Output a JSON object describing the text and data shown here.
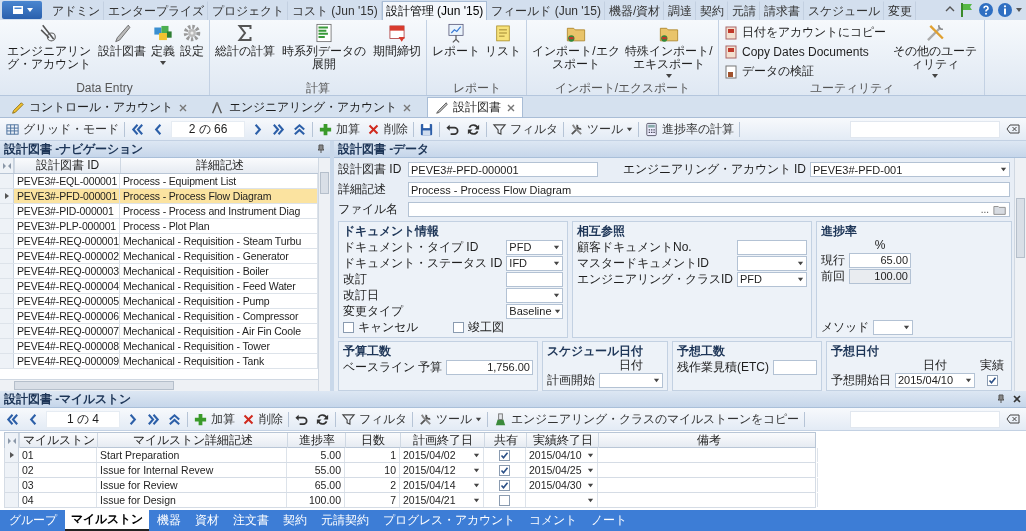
{
  "ribbon": {
    "tabs": [
      {
        "label": "アドミン",
        "selected": false
      },
      {
        "label": "エンタープライズ",
        "selected": false
      },
      {
        "label": "プロジェクト",
        "selected": false
      },
      {
        "label": "コスト (Jun '15)",
        "selected": false
      },
      {
        "label": "設計管理 (Jun '15)",
        "selected": true
      },
      {
        "label": "フィールド (Jun '15)",
        "selected": false
      },
      {
        "label": "機器/資材",
        "selected": false
      },
      {
        "label": "調達",
        "selected": false
      },
      {
        "label": "契約",
        "selected": false
      },
      {
        "label": "元請",
        "selected": false
      },
      {
        "label": "請求書",
        "selected": false
      },
      {
        "label": "スケジュール",
        "selected": false
      },
      {
        "label": "変更",
        "selected": false
      }
    ],
    "groups": [
      {
        "label": "Data Entry",
        "items": [
          {
            "label": "エンジニアリング・アカウント",
            "kind": "large",
            "dropdown": false
          },
          {
            "label": "設計図書",
            "kind": "large",
            "dropdown": false
          },
          {
            "label": "定義",
            "kind": "large",
            "dropdown": true
          },
          {
            "label": "設定",
            "kind": "large",
            "dropdown": false
          }
        ]
      },
      {
        "label": "計算",
        "items": [
          {
            "label": "総計の計算",
            "kind": "large",
            "dropdown": false
          },
          {
            "label": "時系列データの展開",
            "kind": "large",
            "dropdown": false
          },
          {
            "label": "期間締切",
            "kind": "large",
            "dropdown": false
          }
        ]
      },
      {
        "label": "レポート",
        "items": [
          {
            "label": "レポート",
            "kind": "large",
            "dropdown": false
          },
          {
            "label": "リスト",
            "kind": "large",
            "dropdown": false
          }
        ]
      },
      {
        "label": "インポート/エクスポート",
        "items": [
          {
            "label": "インポート/エクスポート",
            "kind": "large",
            "dropdown": false
          },
          {
            "label": "特殊インポート/エキスポート",
            "kind": "large",
            "dropdown": true
          }
        ]
      },
      {
        "label": "ユーティリティ",
        "items": [
          {
            "label": "日付をアカウントにコピー",
            "kind": "small",
            "dropdown": false
          },
          {
            "label": "Copy Dates Documents",
            "kind": "small",
            "dropdown": false
          },
          {
            "label": "データの検証",
            "kind": "small",
            "dropdown": false
          },
          {
            "label": "その他のユーティリティ",
            "kind": "large",
            "dropdown": true
          }
        ]
      }
    ]
  },
  "doc_tabs": [
    {
      "label": "コントロール・アカウント",
      "selected": false
    },
    {
      "label": "エンジニアリング・アカウント",
      "selected": false
    },
    {
      "label": "設計図書",
      "selected": true
    }
  ],
  "toolbar": {
    "items": [
      {
        "kind": "grid",
        "label": "グリッド・モード"
      },
      {
        "kind": "sep"
      },
      {
        "kind": "first"
      },
      {
        "kind": "prev"
      },
      {
        "kind": "pager",
        "label": "2 の 66"
      },
      {
        "kind": "next"
      },
      {
        "kind": "last"
      },
      {
        "kind": "up"
      },
      {
        "kind": "sep"
      },
      {
        "kind": "add",
        "label": "加算"
      },
      {
        "kind": "delete",
        "label": "削除"
      },
      {
        "kind": "sep"
      },
      {
        "kind": "save"
      },
      {
        "kind": "sep"
      },
      {
        "kind": "undo"
      },
      {
        "kind": "refresh"
      },
      {
        "kind": "sep"
      },
      {
        "kind": "filter",
        "label": "フィルタ"
      },
      {
        "kind": "sep"
      },
      {
        "kind": "tools",
        "label": "ツール",
        "dropdown": true
      },
      {
        "kind": "sep"
      },
      {
        "kind": "calc",
        "label": "進捗率の計算"
      },
      {
        "kind": "sep"
      },
      {
        "kind": "search"
      }
    ]
  },
  "navigation": {
    "title": "設計図書 -ナビゲーション",
    "columns": [
      "設計図書 ID",
      "詳細記述"
    ],
    "rows": [
      {
        "id": "PEVE3#-EQL-000001",
        "description": "Process - Equipment List",
        "selected": false
      },
      {
        "id": "PEVE3#-PFD-000001",
        "description": "Process - Process Flow Diagram",
        "selected": true
      },
      {
        "id": "PEVE3#-PID-000001",
        "description": "Process - Process and Instrument Diag",
        "selected": false
      },
      {
        "id": "PEVE3#-PLP-000001",
        "description": "Process - Plot Plan",
        "selected": false
      },
      {
        "id": "PEVE4#-REQ-000001",
        "description": "Mechanical - Requisition - Steam Turbu",
        "selected": false
      },
      {
        "id": "PEVE4#-REQ-000002",
        "description": "Mechanical - Requisition - Generator",
        "selected": false
      },
      {
        "id": "PEVE4#-REQ-000003",
        "description": "Mechanical - Requisition - Boiler",
        "selected": false
      },
      {
        "id": "PEVE4#-REQ-000004",
        "description": "Mechanical - Requisition - Feed Water",
        "selected": false
      },
      {
        "id": "PEVE4#-REQ-000005",
        "description": "Mechanical - Requisition - Pump",
        "selected": false
      },
      {
        "id": "PEVE4#-REQ-000006",
        "description": "Mechanical - Requisition - Compressor",
        "selected": false
      },
      {
        "id": "PEVE4#-REQ-000007",
        "description": "Mechanical - Requisition - Air Fin Coole",
        "selected": false
      },
      {
        "id": "PEVE4#-REQ-000008",
        "description": "Mechanical - Requisition - Tower",
        "selected": false
      },
      {
        "id": "PEVE4#-REQ-000009",
        "description": "Mechanical - Requisition - Tank",
        "selected": false
      }
    ]
  },
  "data_panel": {
    "title": "設計図書 -データ",
    "rows": [
      [
        {
          "label": "設計図書 ID",
          "kind": "text",
          "value": "PEVE3#-PFD-000001"
        },
        {
          "label": "エンジニアリング・アカウント ID",
          "kind": "combo",
          "value": "PEVE3#-PFD-001"
        }
      ],
      [
        {
          "label": "詳細記述",
          "kind": "text",
          "value": "Process - Process Flow Diagram"
        }
      ],
      [
        {
          "label": "ファイル名",
          "kind": "file",
          "browse_label": "..."
        }
      ]
    ],
    "upper_sections": [
      {
        "title": "ドキュメント情報",
        "fields": [
          {
            "label": "ドキュメント・タイプ ID",
            "kind": "combo",
            "value": "PFD"
          },
          {
            "label": "ドキュメント・ステータス ID",
            "kind": "combo",
            "value": "IFD"
          },
          {
            "label": "改訂",
            "kind": "text"
          },
          {
            "label": "改訂日",
            "kind": "date"
          },
          {
            "label": "変更タイプ",
            "kind": "combo",
            "value": "Baseline"
          }
        ],
        "checkboxes": [
          {
            "label": "キャンセル",
            "checked": false
          },
          {
            "label": "竣工図",
            "checked": false
          }
        ]
      },
      {
        "title": "相互参照",
        "fields": [
          {
            "label": "顧客ドキュメントNo.",
            "kind": "text"
          },
          {
            "label": "マスタードキュメントID",
            "kind": "combo"
          },
          {
            "label": "エンジニアリング・クラスID",
            "kind": "combo",
            "value": "PFD"
          }
        ]
      },
      {
        "title": "進捗率",
        "headers": [
          "%"
        ],
        "fields": [
          {
            "label": "現行",
            "kind": "number",
            "value": "65.00"
          },
          {
            "label": "前回",
            "kind": "readonly",
            "value": "100.00"
          }
        ],
        "footer_fields": [
          {
            "label": "メソッド",
            "kind": "combo"
          }
        ]
      }
    ],
    "lower_sections": [
      {
        "title": "予算工数",
        "fields": [
          {
            "label": "ベースライン 予算",
            "kind": "number",
            "value": "1,756.00"
          }
        ]
      },
      {
        "title": "スケジュール日付",
        "headers": [
          "日付"
        ],
        "fields": [
          {
            "label": "計画開始",
            "kind": "date"
          }
        ]
      },
      {
        "title": "予想工数",
        "fields": [
          {
            "label": "残作業見積(ETC)",
            "kind": "text"
          }
        ]
      },
      {
        "title": "予想日付",
        "headers": [
          "日付",
          "実績"
        ],
        "fields": [
          {
            "label": "予想開始日",
            "kind": "date",
            "value": "2015/04/10",
            "checked": true
          }
        ]
      }
    ]
  },
  "milestones": {
    "title": "設計図書 -マイルストン",
    "toolbar": {
      "items": [
        {
          "kind": "first"
        },
        {
          "kind": "prev"
        },
        {
          "kind": "pager",
          "label": "1 の 4"
        },
        {
          "kind": "next"
        },
        {
          "kind": "last"
        },
        {
          "kind": "up"
        },
        {
          "kind": "sep"
        },
        {
          "kind": "add",
          "label": "加算"
        },
        {
          "kind": "delete",
          "label": "削除"
        },
        {
          "kind": "sep"
        },
        {
          "kind": "undo"
        },
        {
          "kind": "refresh"
        },
        {
          "kind": "sep"
        },
        {
          "kind": "filter",
          "label": "フィルタ"
        },
        {
          "kind": "sep"
        },
        {
          "kind": "tools",
          "label": "ツール",
          "dropdown": true
        },
        {
          "kind": "sep"
        },
        {
          "kind": "copy",
          "label": "エンジニアリング・クラスのマイルストーンをコピー"
        },
        {
          "kind": "sep"
        },
        {
          "kind": "search"
        }
      ]
    },
    "columns": [
      "マイルストン",
      "マイルストン詳細記述",
      "進捗率",
      "日数",
      "計画終了日",
      "共有",
      "実績終了日",
      "備考"
    ],
    "rows": [
      {
        "selected": true,
        "milestone": "01",
        "description": "Start Preparation",
        "progress": "5.00",
        "days": "1",
        "planned_finish": "2015/04/02",
        "shared": true,
        "actual_finish": "2015/04/10"
      },
      {
        "selected": false,
        "milestone": "02",
        "description": "Issue for Internal Revew",
        "progress": "55.00",
        "days": "10",
        "planned_finish": "2015/04/12",
        "shared": true,
        "actual_finish": "2015/04/25"
      },
      {
        "selected": false,
        "milestone": "03",
        "description": "Issue for Review",
        "progress": "65.00",
        "days": "2",
        "planned_finish": "2015/04/14",
        "shared": true,
        "actual_finish": "2015/04/30"
      },
      {
        "selected": false,
        "milestone": "04",
        "description": "Issue for Design",
        "progress": "100.00",
        "days": "7",
        "planned_finish": "2015/04/21",
        "shared": false
      }
    ]
  },
  "bottom_tabs": [
    {
      "label": "グループ",
      "selected": false
    },
    {
      "label": "マイルストン",
      "selected": true
    },
    {
      "label": "機器",
      "selected": false
    },
    {
      "label": "資材",
      "selected": false
    },
    {
      "label": "注文書",
      "selected": false
    },
    {
      "label": "契約",
      "selected": false
    },
    {
      "label": "元請契約",
      "selected": false
    },
    {
      "label": "プログレス・アカウント",
      "selected": false
    },
    {
      "label": "コメント",
      "selected": false
    },
    {
      "label": "ノート",
      "selected": false
    }
  ]
}
